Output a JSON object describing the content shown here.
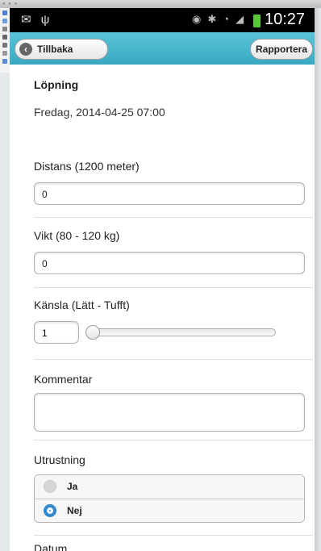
{
  "header": {
    "back_label": "Tillbaka",
    "report_label": "Rapportera"
  },
  "statusbar": {
    "time": "10:27"
  },
  "info": {
    "activity": "Löpning",
    "datetime": "Fredag, 2014-04-25 07:00"
  },
  "form": {
    "distance": {
      "label": "Distans (1200 meter)",
      "value": "0"
    },
    "weight": {
      "label": "Vikt (80 - 120 kg)",
      "value": "0"
    },
    "feeling": {
      "label": "Känsla (Lätt - Tufft)",
      "value": "1"
    },
    "comment": {
      "label": "Kommentar",
      "value": ""
    },
    "equipment": {
      "label": "Utrustning",
      "options": [
        {
          "label": "Ja",
          "selected": false
        },
        {
          "label": "Nej",
          "selected": true
        }
      ]
    },
    "date": {
      "label": "Datum"
    }
  },
  "colors": {
    "header": "#44b0c8",
    "radio_selected": "#3388cc"
  }
}
